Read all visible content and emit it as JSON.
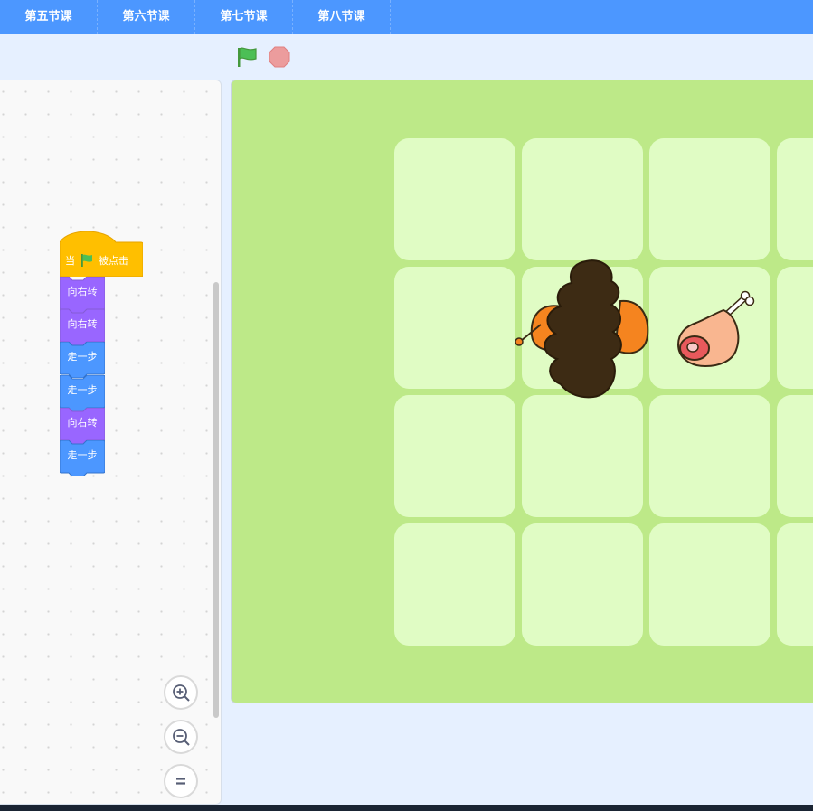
{
  "tabs": [
    {
      "label": "第五节课"
    },
    {
      "label": "第六节课"
    },
    {
      "label": "第七节课"
    },
    {
      "label": "第八节课"
    }
  ],
  "controls": {
    "green_flag_icon": "green-flag-icon",
    "stop_icon": "stop-icon"
  },
  "script": {
    "hat": {
      "prefix": "当",
      "suffix": "被点击"
    },
    "blocks": [
      {
        "label": "向右转",
        "category": "turn",
        "color": "#9966ff"
      },
      {
        "label": "向右转",
        "category": "turn",
        "color": "#9966ff"
      },
      {
        "label": "走一步",
        "category": "move",
        "color": "#4c97ff"
      },
      {
        "label": "走一步",
        "category": "move",
        "color": "#4c97ff"
      },
      {
        "label": "向右转",
        "category": "turn",
        "color": "#9966ff"
      },
      {
        "label": "走一步",
        "category": "move",
        "color": "#4c97ff"
      }
    ]
  },
  "zoom": {
    "zoom_in_icon": "zoom-in-icon",
    "zoom_out_icon": "zoom-out-icon",
    "reset_icon": "zoom-reset-icon"
  },
  "stage": {
    "grid_columns_visible": 4,
    "grid_rows_visible": 4,
    "sprites": [
      {
        "name": "turkey-icon"
      },
      {
        "name": "meat-icon"
      }
    ]
  },
  "colors": {
    "tab_bar": "#4c97ff",
    "hat_block": "#ffbf00",
    "turn_block": "#9966ff",
    "move_block": "#4c97ff",
    "stage_background": "#bde988",
    "tile": "#e0fcc4"
  }
}
